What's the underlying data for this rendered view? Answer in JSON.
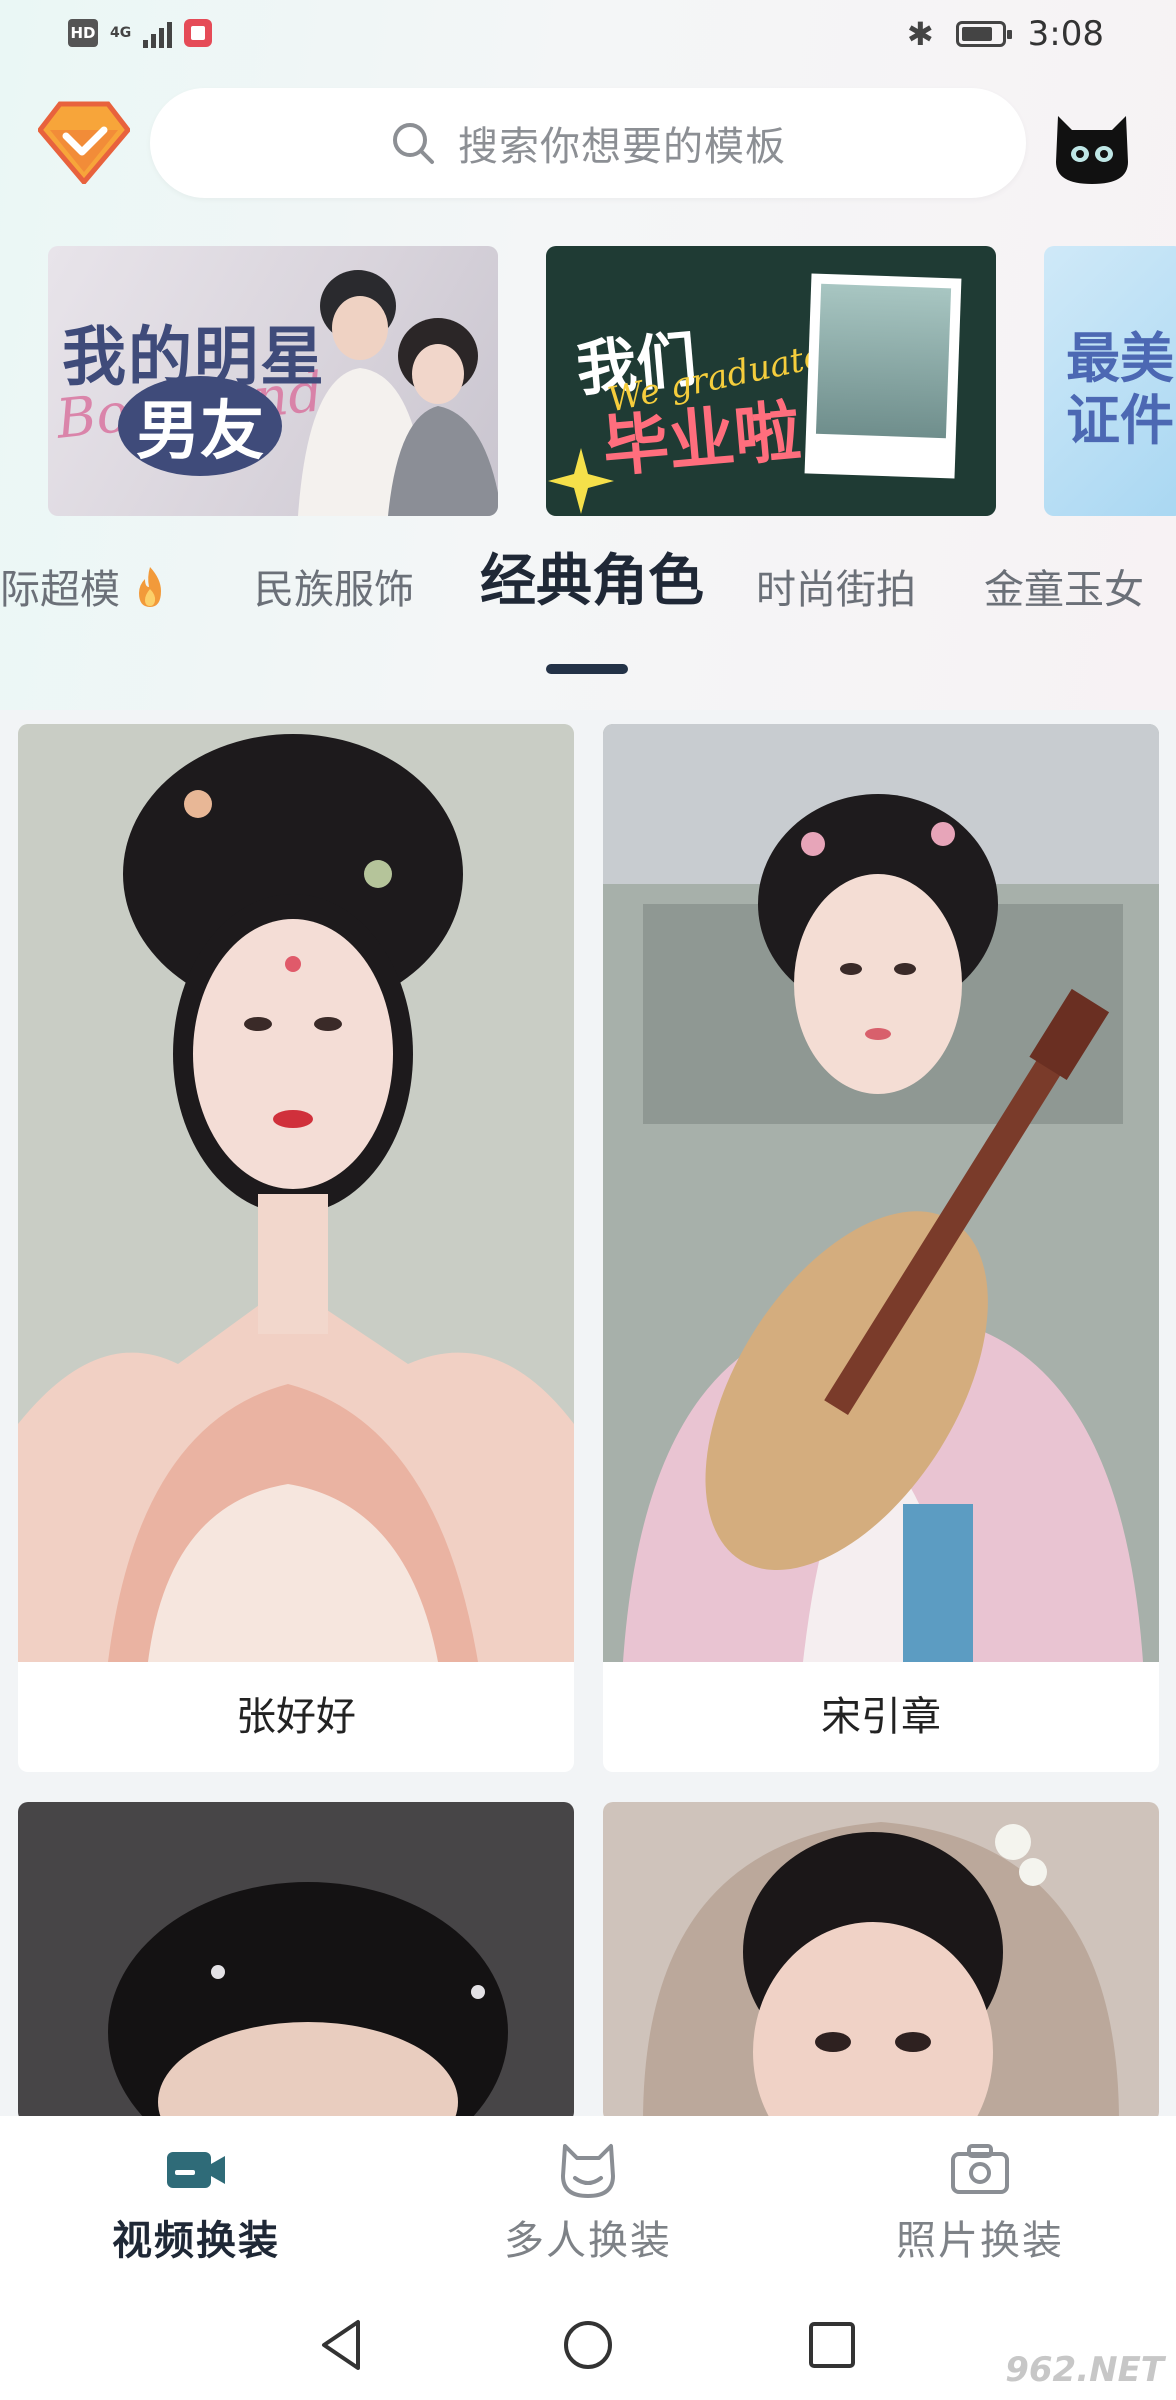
{
  "status_bar": {
    "network": "4G",
    "time": "3:08"
  },
  "search": {
    "placeholder": "搜索你想要的模板"
  },
  "banners": [
    {
      "title_line1": "我的明星",
      "title_line2": "男友",
      "script": "Boyfriend"
    },
    {
      "title_line1": "我们",
      "title_line2": "毕业啦",
      "script": "We graduated"
    },
    {
      "title": "最美证件"
    }
  ],
  "tabs": [
    {
      "label": "际超模",
      "has_fire": true
    },
    {
      "label": "民族服饰"
    },
    {
      "label": "经典角色",
      "active": true
    },
    {
      "label": "时尚街拍"
    },
    {
      "label": "金童玉女"
    }
  ],
  "cards": [
    {
      "name": "张好好"
    },
    {
      "name": "宋引章"
    },
    {
      "name": ""
    },
    {
      "name": ""
    }
  ],
  "bottom_nav": [
    {
      "label": "视频换装",
      "icon": "video-camera-icon",
      "active": true
    },
    {
      "label": "多人换装",
      "icon": "cat-face-icon"
    },
    {
      "label": "照片换装",
      "icon": "photo-camera-icon"
    }
  ],
  "colors": {
    "active_text": "#1f2836",
    "inactive_text": "#7e8287",
    "accent_tab_line": "#233247"
  },
  "watermark": "962.NET"
}
